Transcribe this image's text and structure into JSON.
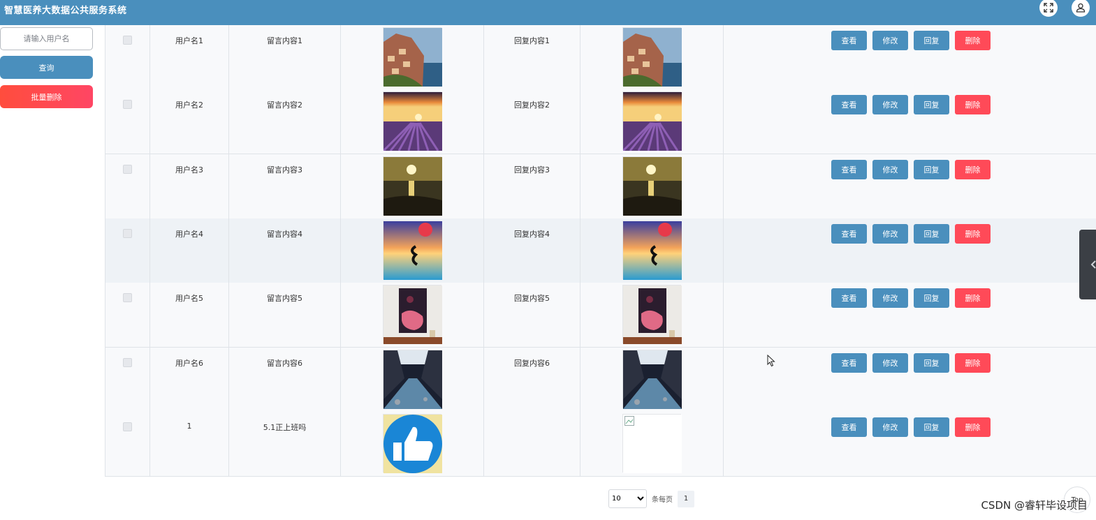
{
  "header": {
    "title": "智慧医养大数据公共服务系统",
    "fullscreen_icon": "fullscreen-icon",
    "user_icon": "user-icon"
  },
  "sidebar": {
    "search_placeholder": "请输入用户名",
    "query_label": "查询",
    "batch_delete_label": "批量删除"
  },
  "rows": [
    {
      "username": "用户名1",
      "message": "留言内容1",
      "reply": "回复内容1",
      "image": "coast-cliff-village",
      "reply_image": "coast-cliff-village"
    },
    {
      "username": "用户名2",
      "message": "留言内容2",
      "reply": "回复内容2",
      "image": "lavender-field-sunset",
      "reply_image": "lavender-field-sunset"
    },
    {
      "username": "用户名3",
      "message": "留言内容3",
      "reply": "回复内容3",
      "image": "beach-sunset",
      "reply_image": "beach-sunset"
    },
    {
      "username": "用户名4",
      "message": "留言内容4",
      "reply": "回复内容4",
      "image": "colorful-sky-reflection",
      "reply_image": "colorful-sky-reflection"
    },
    {
      "username": "用户名5",
      "message": "留言内容5",
      "reply": "回复内容5",
      "image": "framed-painting",
      "reply_image": "framed-painting"
    },
    {
      "username": "用户名6",
      "message": "留言内容6",
      "reply": "回复内容6",
      "image": "river-canyon",
      "reply_image": "river-canyon"
    },
    {
      "username": "1",
      "message": "5.1正上班吗",
      "reply": "",
      "image": "thumbs-up",
      "reply_image": "broken-image"
    }
  ],
  "actions": {
    "view": "查看",
    "edit": "修改",
    "reply": "回复",
    "delete": "删除"
  },
  "pagination": {
    "page_size": "10",
    "per_page_label": "条每页",
    "current_page": "1"
  },
  "top_button_label": "Top",
  "watermark": "CSDN @睿轩毕设项目",
  "colors": {
    "primary": "#4a8fbd",
    "danger": "#ff4a58"
  }
}
